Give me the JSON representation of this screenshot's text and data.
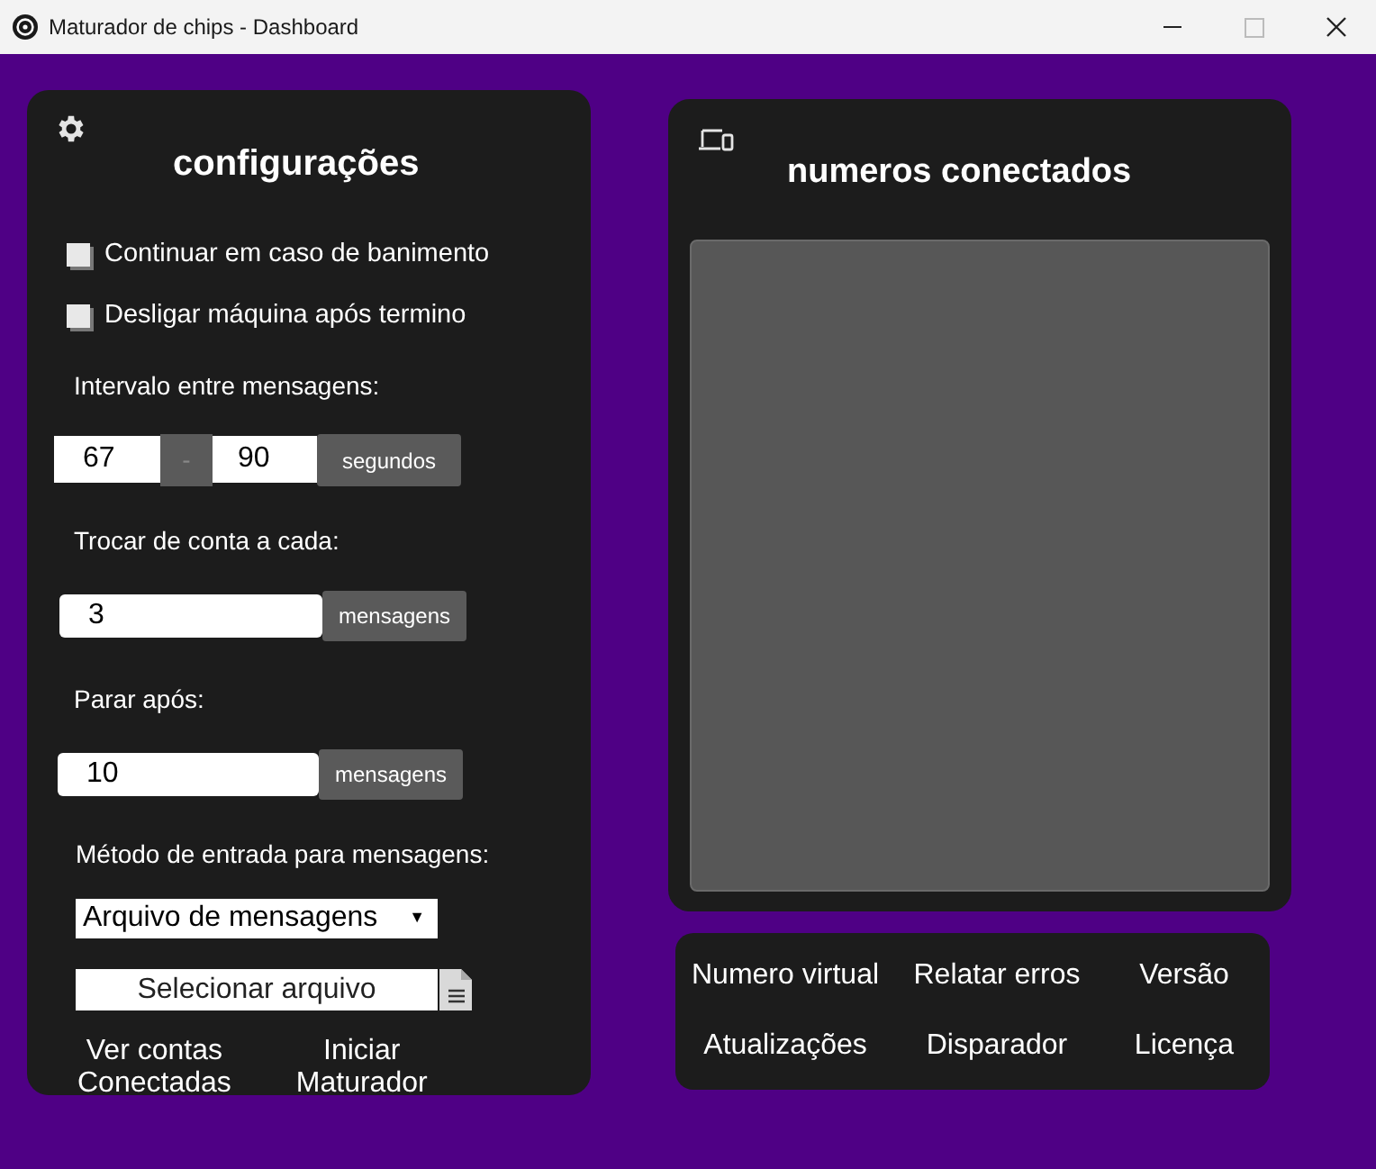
{
  "window": {
    "title": "Maturador de chips - Dashboard"
  },
  "settings": {
    "title": "configurações",
    "options": [
      {
        "label": "Continuar em caso de banimento",
        "checked": false
      },
      {
        "label": "Desligar máquina após termino",
        "checked": false
      }
    ],
    "interval": {
      "label": "Intervalo entre mensagens:",
      "min": "67",
      "separator": "-",
      "max": "90",
      "unit": "segundos"
    },
    "switch_account": {
      "label": "Trocar de conta a cada:",
      "value": "3",
      "unit": "mensagens"
    },
    "stop_after": {
      "label": "Parar após:",
      "value": "10",
      "unit": "mensagens"
    },
    "input_method": {
      "label": "Método de entrada para mensagens:",
      "value": "Arquivo de mensagens",
      "arrow": "▼"
    },
    "file_button": "Selecionar arquivo",
    "actions": [
      "Ver contas\nConectadas",
      "Iniciar\nMaturador"
    ]
  },
  "connected": {
    "title": "numeros conectados"
  },
  "links": [
    "Numero virtual",
    "Relatar erros",
    "Versão",
    "Atualizações",
    "Disparador",
    "Licença"
  ]
}
